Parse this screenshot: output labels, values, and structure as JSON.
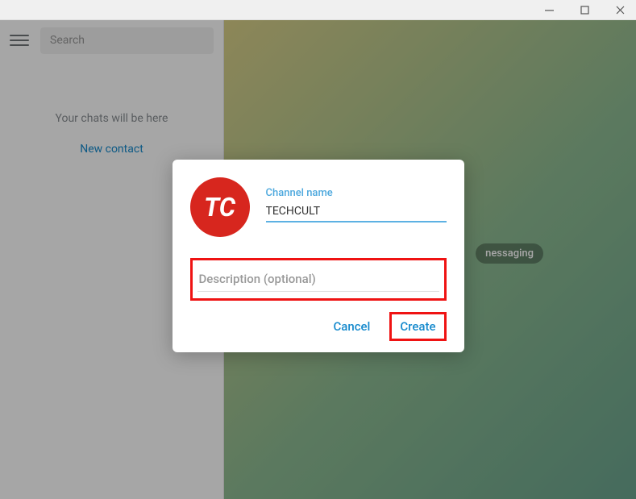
{
  "window": {
    "minimize_tooltip": "Minimize",
    "maximize_tooltip": "Maximize",
    "close_tooltip": "Close"
  },
  "sidebar": {
    "search_placeholder": "Search",
    "empty_text": "Your chats will be here",
    "new_contact_label": "New contact"
  },
  "main": {
    "badge_text": "nessaging"
  },
  "modal": {
    "channel_name_label": "Channel name",
    "channel_name_value": "TECHCULT",
    "avatar_text": "TC",
    "description_placeholder": "Description (optional)",
    "description_value": "",
    "cancel_label": "Cancel",
    "create_label": "Create"
  },
  "colors": {
    "accent": "#168acd",
    "avatar_bg": "#d7261e",
    "highlight_border": "#ef1313"
  }
}
